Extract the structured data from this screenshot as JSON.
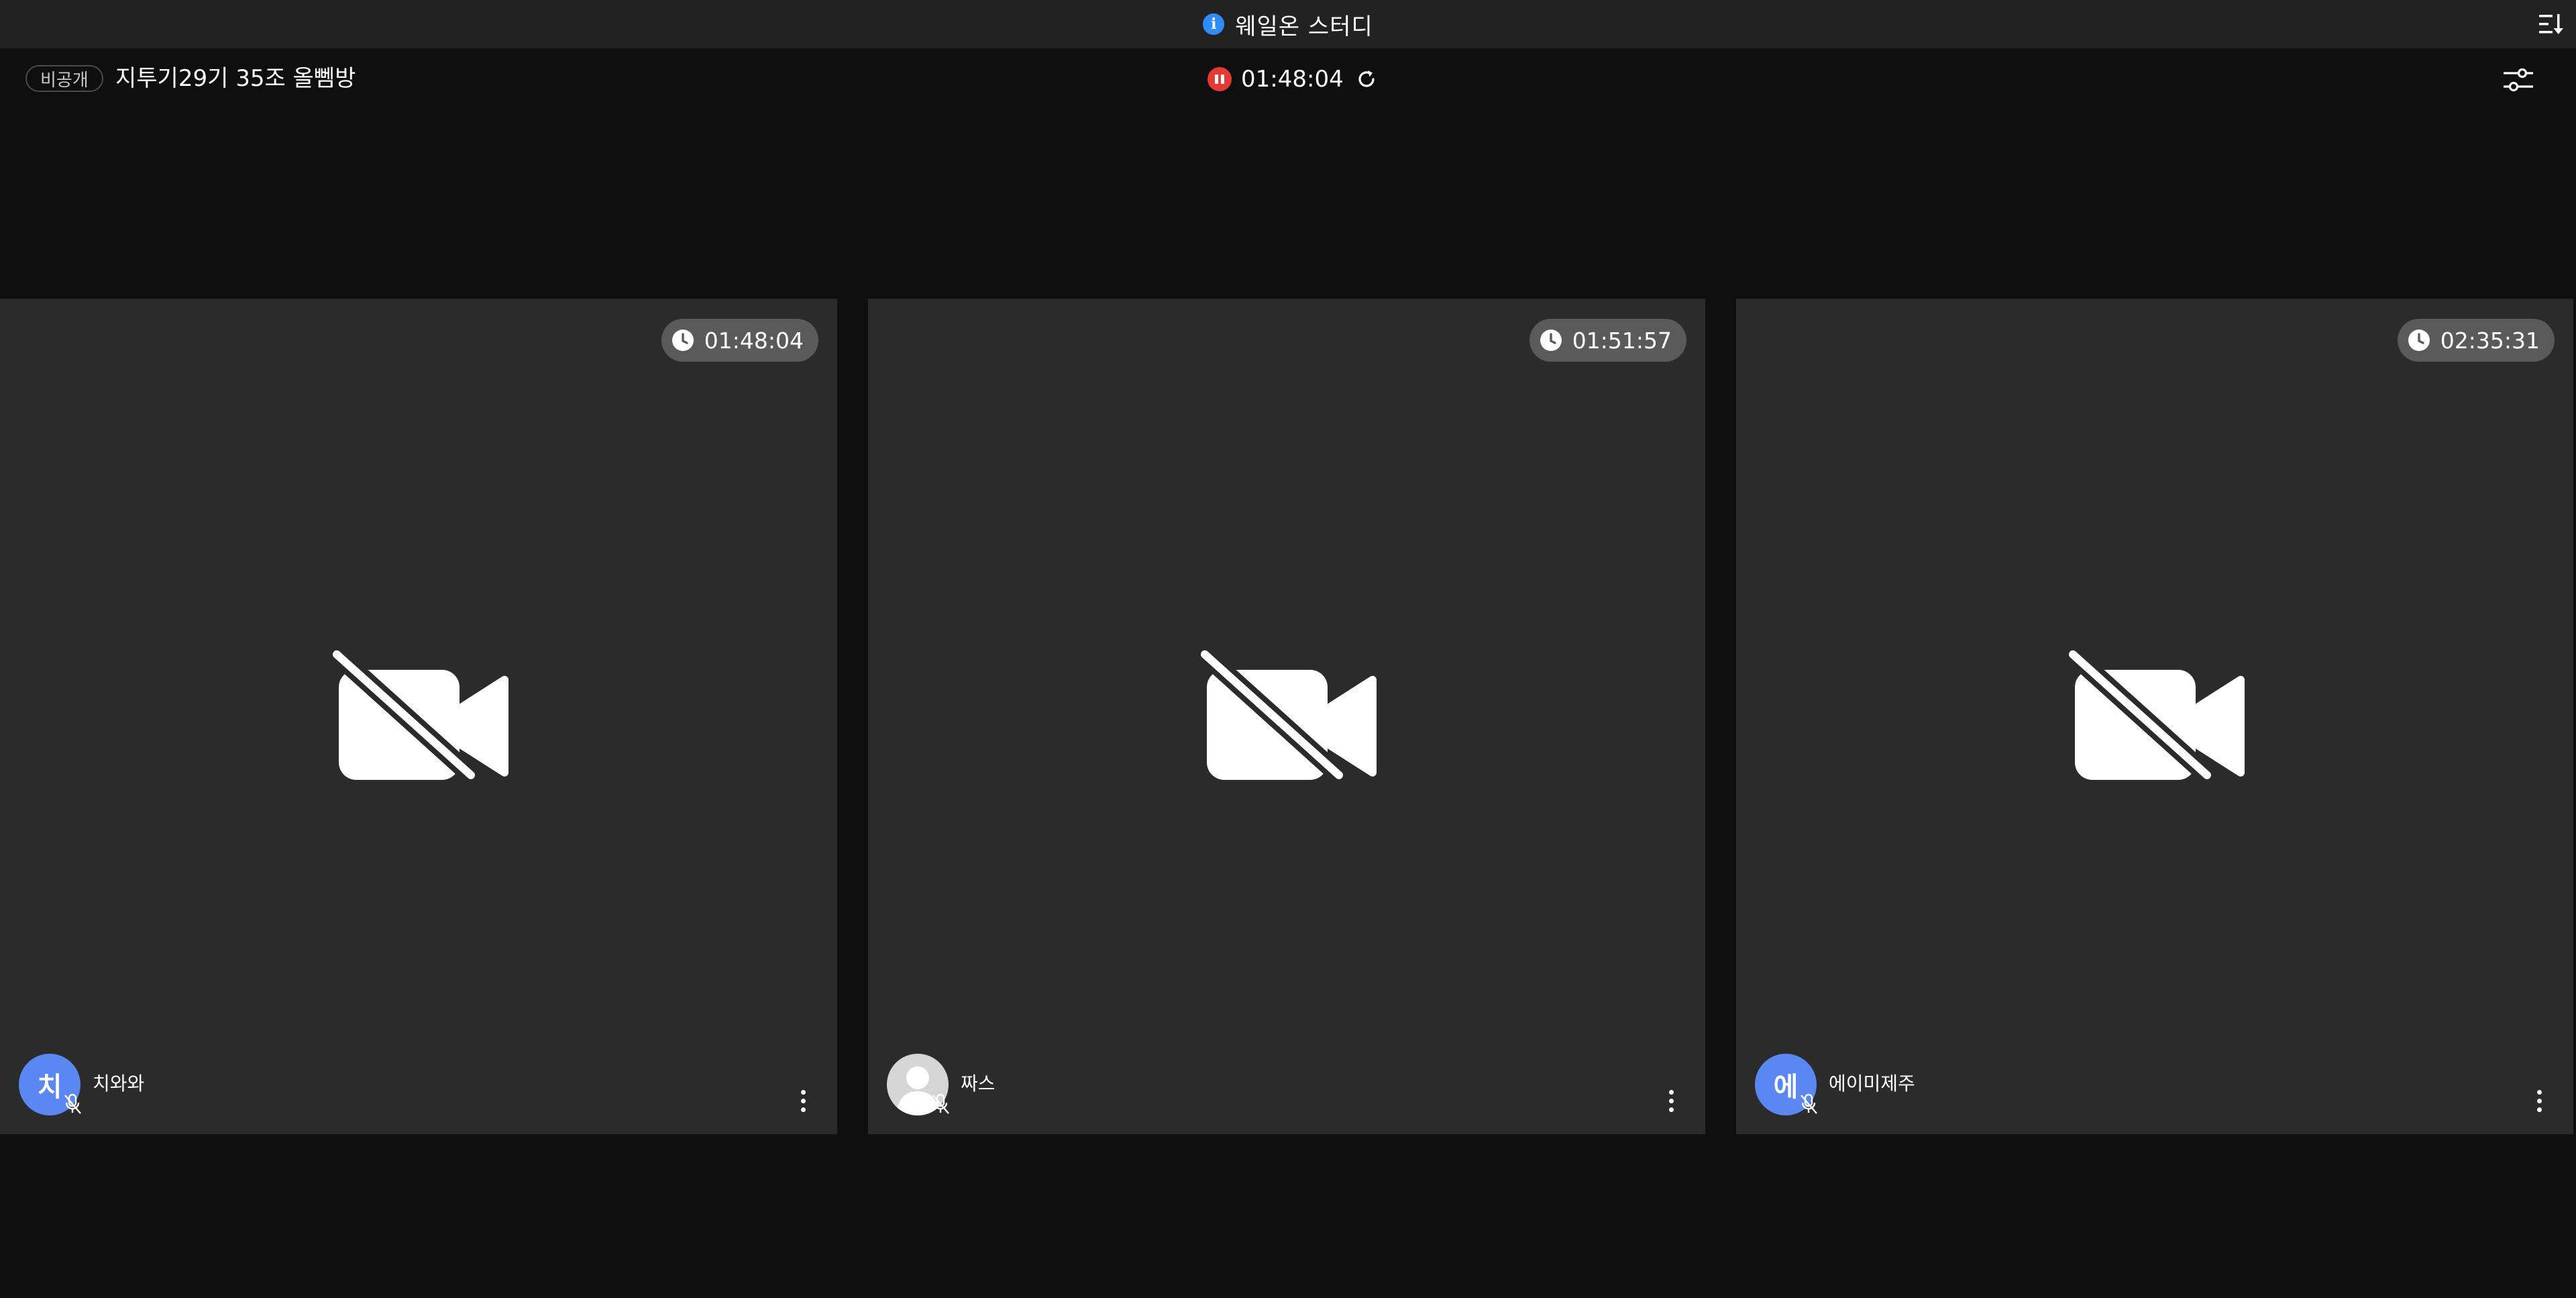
{
  "topbar": {
    "title": "웨일온 스터디",
    "info_icon": "info-icon",
    "sort_icon": "sort-list-icon",
    "info_color": "#2f8cff"
  },
  "room": {
    "badge": "비공개",
    "name": "지투기29기 35조 올뻼방",
    "timer": "01:48:04",
    "pause_icon": "pause-icon",
    "pause_color": "#e53935",
    "refresh_icon": "refresh-icon",
    "settings_icon": "sliders-icon"
  },
  "participants": [
    {
      "name": "치와와",
      "avatar_letter": "치",
      "avatar_type": "letter",
      "timer": "01:48:04",
      "camera": "off",
      "mic": "muted"
    },
    {
      "name": "짜스",
      "avatar_letter": "",
      "avatar_type": "photo",
      "timer": "01:51:57",
      "camera": "off",
      "mic": "muted"
    },
    {
      "name": "에이미제주",
      "avatar_letter": "에",
      "avatar_type": "letter",
      "timer": "02:35:31",
      "camera": "off",
      "mic": "muted"
    }
  ],
  "colors": {
    "background": "#0f0f0f",
    "topbar": "#222222",
    "tile": "#2b2b2b",
    "timer_pill": "#5a5a5a",
    "avatar": "#5b87f2"
  }
}
